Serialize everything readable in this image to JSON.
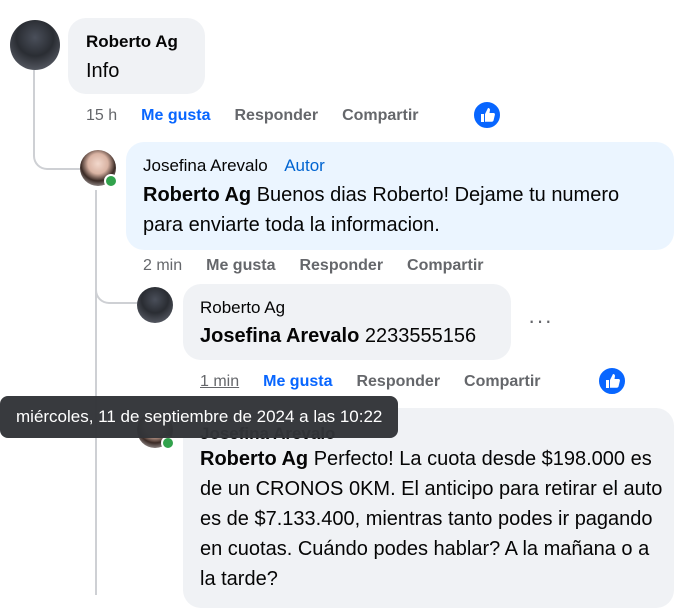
{
  "comments": [
    {
      "author": "Roberto Ag",
      "text": "Info",
      "time": "15 h",
      "like_label": "Me gusta",
      "reply_label": "Responder",
      "share_label": "Compartir"
    },
    {
      "author": "Josefina Arevalo",
      "badge": "Autor",
      "mention": "Roberto Ag",
      "text": "Buenos dias Roberto! Dejame tu numero para enviarte toda la informacion.",
      "time": "2 min",
      "like_label": "Me gusta",
      "reply_label": "Responder",
      "share_label": "Compartir"
    },
    {
      "author": "Roberto Ag",
      "mention": "Josefina Arevalo",
      "text": "2233555156",
      "time": "1 min",
      "like_label": "Me gusta",
      "reply_label": "Responder",
      "share_label": "Compartir",
      "more_label": "···"
    },
    {
      "author": "Josefina Arevalo",
      "mention": "Roberto Ag",
      "text": "Perfecto! La cuota desde $198.000 es de un CRONOS 0KM. El anticipo para retirar el auto es de $7.133.400, mientras tanto podes ir pagando en cuotas. Cuándo podes hablar? A la mañana o a la tarde?"
    }
  ],
  "tooltip": "miércoles, 11 de septiembre de 2024 a las 10:22",
  "colors": {
    "bubble": "#f0f2f5",
    "author_bubble": "#ebf5ff",
    "link": "#0866ff",
    "muted": "#65676b",
    "online": "#31a24c"
  },
  "icons": {
    "reaction": "thumbs-up-icon"
  }
}
